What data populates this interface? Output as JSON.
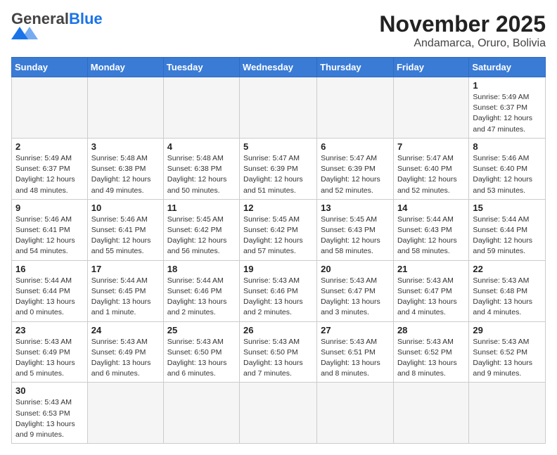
{
  "header": {
    "logo_general": "General",
    "logo_blue": "Blue",
    "title": "November 2025",
    "subtitle": "Andamarca, Oruro, Bolivia"
  },
  "days_of_week": [
    "Sunday",
    "Monday",
    "Tuesday",
    "Wednesday",
    "Thursday",
    "Friday",
    "Saturday"
  ],
  "weeks": [
    [
      {
        "day": "",
        "info": ""
      },
      {
        "day": "",
        "info": ""
      },
      {
        "day": "",
        "info": ""
      },
      {
        "day": "",
        "info": ""
      },
      {
        "day": "",
        "info": ""
      },
      {
        "day": "",
        "info": ""
      },
      {
        "day": "1",
        "info": "Sunrise: 5:49 AM\nSunset: 6:37 PM\nDaylight: 12 hours\nand 47 minutes."
      }
    ],
    [
      {
        "day": "2",
        "info": "Sunrise: 5:49 AM\nSunset: 6:37 PM\nDaylight: 12 hours\nand 48 minutes."
      },
      {
        "day": "3",
        "info": "Sunrise: 5:48 AM\nSunset: 6:38 PM\nDaylight: 12 hours\nand 49 minutes."
      },
      {
        "day": "4",
        "info": "Sunrise: 5:48 AM\nSunset: 6:38 PM\nDaylight: 12 hours\nand 50 minutes."
      },
      {
        "day": "5",
        "info": "Sunrise: 5:47 AM\nSunset: 6:39 PM\nDaylight: 12 hours\nand 51 minutes."
      },
      {
        "day": "6",
        "info": "Sunrise: 5:47 AM\nSunset: 6:39 PM\nDaylight: 12 hours\nand 52 minutes."
      },
      {
        "day": "7",
        "info": "Sunrise: 5:47 AM\nSunset: 6:40 PM\nDaylight: 12 hours\nand 52 minutes."
      },
      {
        "day": "8",
        "info": "Sunrise: 5:46 AM\nSunset: 6:40 PM\nDaylight: 12 hours\nand 53 minutes."
      }
    ],
    [
      {
        "day": "9",
        "info": "Sunrise: 5:46 AM\nSunset: 6:41 PM\nDaylight: 12 hours\nand 54 minutes."
      },
      {
        "day": "10",
        "info": "Sunrise: 5:46 AM\nSunset: 6:41 PM\nDaylight: 12 hours\nand 55 minutes."
      },
      {
        "day": "11",
        "info": "Sunrise: 5:45 AM\nSunset: 6:42 PM\nDaylight: 12 hours\nand 56 minutes."
      },
      {
        "day": "12",
        "info": "Sunrise: 5:45 AM\nSunset: 6:42 PM\nDaylight: 12 hours\nand 57 minutes."
      },
      {
        "day": "13",
        "info": "Sunrise: 5:45 AM\nSunset: 6:43 PM\nDaylight: 12 hours\nand 58 minutes."
      },
      {
        "day": "14",
        "info": "Sunrise: 5:44 AM\nSunset: 6:43 PM\nDaylight: 12 hours\nand 58 minutes."
      },
      {
        "day": "15",
        "info": "Sunrise: 5:44 AM\nSunset: 6:44 PM\nDaylight: 12 hours\nand 59 minutes."
      }
    ],
    [
      {
        "day": "16",
        "info": "Sunrise: 5:44 AM\nSunset: 6:44 PM\nDaylight: 13 hours\nand 0 minutes."
      },
      {
        "day": "17",
        "info": "Sunrise: 5:44 AM\nSunset: 6:45 PM\nDaylight: 13 hours\nand 1 minute."
      },
      {
        "day": "18",
        "info": "Sunrise: 5:44 AM\nSunset: 6:46 PM\nDaylight: 13 hours\nand 2 minutes."
      },
      {
        "day": "19",
        "info": "Sunrise: 5:43 AM\nSunset: 6:46 PM\nDaylight: 13 hours\nand 2 minutes."
      },
      {
        "day": "20",
        "info": "Sunrise: 5:43 AM\nSunset: 6:47 PM\nDaylight: 13 hours\nand 3 minutes."
      },
      {
        "day": "21",
        "info": "Sunrise: 5:43 AM\nSunset: 6:47 PM\nDaylight: 13 hours\nand 4 minutes."
      },
      {
        "day": "22",
        "info": "Sunrise: 5:43 AM\nSunset: 6:48 PM\nDaylight: 13 hours\nand 4 minutes."
      }
    ],
    [
      {
        "day": "23",
        "info": "Sunrise: 5:43 AM\nSunset: 6:49 PM\nDaylight: 13 hours\nand 5 minutes."
      },
      {
        "day": "24",
        "info": "Sunrise: 5:43 AM\nSunset: 6:49 PM\nDaylight: 13 hours\nand 6 minutes."
      },
      {
        "day": "25",
        "info": "Sunrise: 5:43 AM\nSunset: 6:50 PM\nDaylight: 13 hours\nand 6 minutes."
      },
      {
        "day": "26",
        "info": "Sunrise: 5:43 AM\nSunset: 6:50 PM\nDaylight: 13 hours\nand 7 minutes."
      },
      {
        "day": "27",
        "info": "Sunrise: 5:43 AM\nSunset: 6:51 PM\nDaylight: 13 hours\nand 8 minutes."
      },
      {
        "day": "28",
        "info": "Sunrise: 5:43 AM\nSunset: 6:52 PM\nDaylight: 13 hours\nand 8 minutes."
      },
      {
        "day": "29",
        "info": "Sunrise: 5:43 AM\nSunset: 6:52 PM\nDaylight: 13 hours\nand 9 minutes."
      }
    ],
    [
      {
        "day": "30",
        "info": "Sunrise: 5:43 AM\nSunset: 6:53 PM\nDaylight: 13 hours\nand 9 minutes."
      },
      {
        "day": "",
        "info": ""
      },
      {
        "day": "",
        "info": ""
      },
      {
        "day": "",
        "info": ""
      },
      {
        "day": "",
        "info": ""
      },
      {
        "day": "",
        "info": ""
      },
      {
        "day": "",
        "info": ""
      }
    ]
  ]
}
